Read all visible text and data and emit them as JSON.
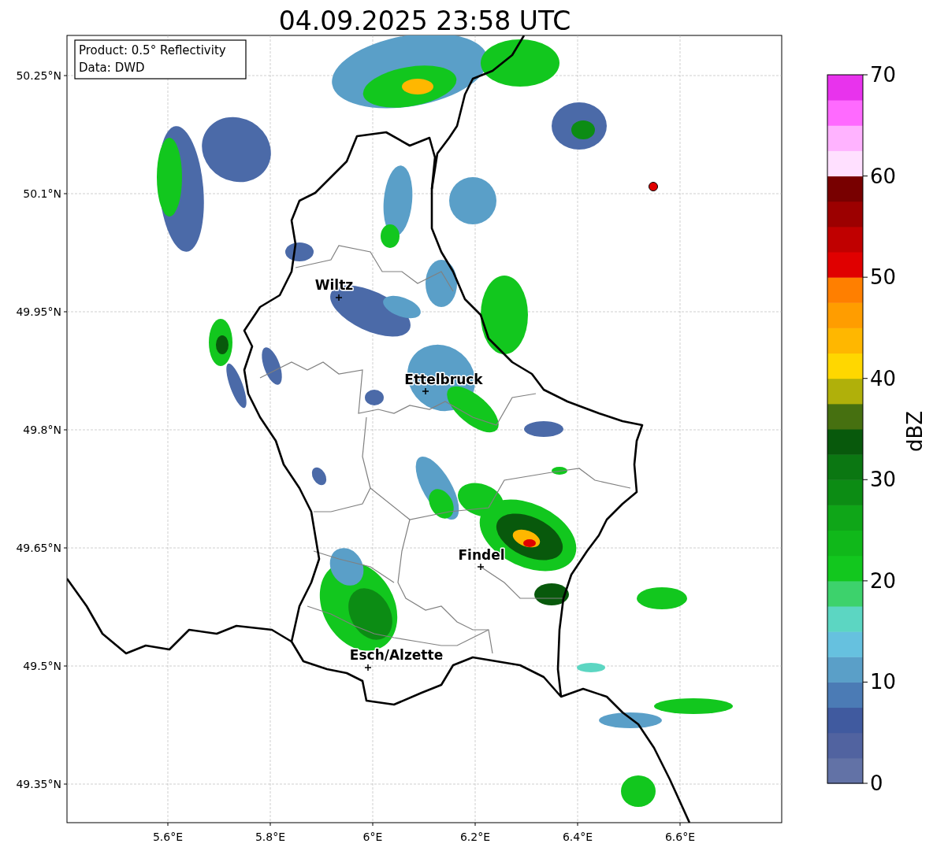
{
  "title": "04.09.2025 23:58 UTC",
  "info_box": {
    "lines": [
      "Product: 0.5° Reflectivity",
      "Data: DWD"
    ]
  },
  "map": {
    "lon_ticks": [
      "5.6°E",
      "5.8°E",
      "6°E",
      "6.2°E",
      "6.4°E",
      "6.6°E"
    ],
    "lat_ticks": [
      "50.25°N",
      "50.1°N",
      "49.95°N",
      "49.8°N",
      "49.65°N",
      "49.5°N",
      "49.35°N"
    ],
    "cities": [
      {
        "name": "Wiltz"
      },
      {
        "name": "Ettelbruck"
      },
      {
        "name": "Findel"
      },
      {
        "name": "Esch/Alzette"
      }
    ]
  },
  "colorbar": {
    "label": "dBZ",
    "ticks": [
      "70",
      "60",
      "50",
      "40",
      "30",
      "20",
      "10",
      "0"
    ],
    "segments": [
      {
        "color": "#6272a6"
      },
      {
        "color": "#5163a0"
      },
      {
        "color": "#405a9f"
      },
      {
        "color": "#4b7bb5"
      },
      {
        "color": "#5a9fc8"
      },
      {
        "color": "#66c1df"
      },
      {
        "color": "#5cd6c2"
      },
      {
        "color": "#3dd26c"
      },
      {
        "color": "#12c71e"
      },
      {
        "color": "#10b81a"
      },
      {
        "color": "#0fa618"
      },
      {
        "color": "#0c8c14"
      },
      {
        "color": "#0b7712"
      },
      {
        "color": "#08590c"
      },
      {
        "color": "#467010"
      },
      {
        "color": "#b0b00a"
      },
      {
        "color": "#ffd700"
      },
      {
        "color": "#ffb700"
      },
      {
        "color": "#ff9d00"
      },
      {
        "color": "#ff7f00"
      },
      {
        "color": "#e00000"
      },
      {
        "color": "#c00000"
      },
      {
        "color": "#9c0000"
      },
      {
        "color": "#780000"
      },
      {
        "color": "#ffe0ff"
      },
      {
        "color": "#ffb3ff"
      },
      {
        "color": "#ff6aff"
      },
      {
        "color": "#e833ed"
      }
    ]
  }
}
